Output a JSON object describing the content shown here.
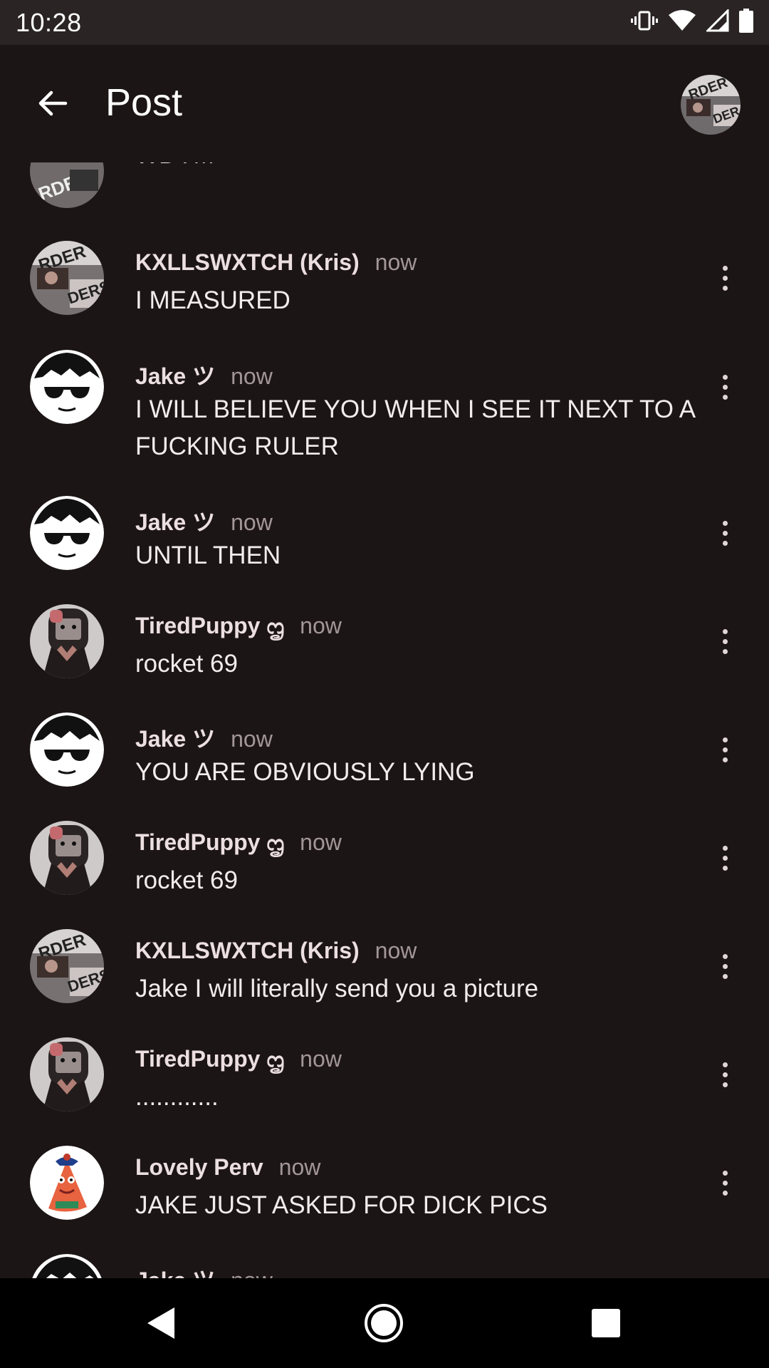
{
  "status_bar": {
    "time": "10:28",
    "icons": [
      "vibrate-icon",
      "wifi-icon",
      "cell-signal-icon",
      "battery-icon"
    ]
  },
  "app_bar": {
    "title": "Post",
    "back_icon": "arrow-back-icon"
  },
  "messages": [
    {
      "user": "",
      "time": "",
      "text": "WDYM",
      "avatar": "kris"
    },
    {
      "user": "KXLLSWXTCH (Kris)",
      "time": "now",
      "text": "I MEASURED",
      "avatar": "kris"
    },
    {
      "user": "Jake ツ",
      "time": "now",
      "text": "I WILL BELIEVE YOU WHEN I SEE IT NEXT TO A FUCKING RULER",
      "avatar": "jake"
    },
    {
      "user": "Jake ツ",
      "time": "now",
      "text": "UNTIL THEN",
      "avatar": "jake"
    },
    {
      "user": "TiredPuppy ᦗ",
      "time": "now",
      "text": "rocket 69",
      "avatar": "puppy"
    },
    {
      "user": "Jake ツ",
      "time": "now",
      "text": "YOU ARE OBVIOUSLY LYING",
      "avatar": "jake"
    },
    {
      "user": "TiredPuppy ᦗ",
      "time": "now",
      "text": "rocket 69",
      "avatar": "puppy"
    },
    {
      "user": "KXLLSWXTCH (Kris)",
      "time": "now",
      "text": "Jake I will literally send you a picture",
      "avatar": "kris"
    },
    {
      "user": "TiredPuppy ᦗ",
      "time": "now",
      "text": "............",
      "avatar": "puppy"
    },
    {
      "user": "Lovely Perv",
      "time": "now",
      "text": "JAKE JUST ASKED FOR DICK PICS",
      "avatar": "perv"
    },
    {
      "user": "Jake ツ",
      "time": "now",
      "text": "",
      "avatar": "jake"
    }
  ],
  "nav_bar": {
    "back": "nav-back-icon",
    "home": "nav-home-icon",
    "recents": "nav-recents-icon"
  },
  "colors": {
    "background": "#1c1516",
    "status_bar": "#2a2425",
    "username": "#ecdfe0",
    "timestamp": "#a29698",
    "nav_bar": "#000000"
  }
}
